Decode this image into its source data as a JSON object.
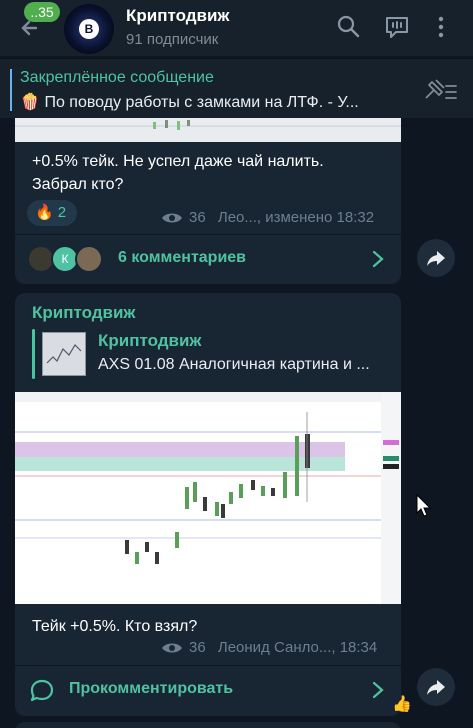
{
  "header": {
    "unread_count": "..35",
    "title": "Криптодвиж",
    "subtitle": "91 подписчик",
    "avatar_letter": "B"
  },
  "pinned": {
    "title": "Закреплённое сообщение",
    "text": "По поводу работы с замками на ЛТФ.  - У...",
    "emoji": "🍿"
  },
  "messages": [
    {
      "text_line1": "+0.5% тейк. Не успел даже чай налить.",
      "text_line2": "Забрал кто?",
      "reaction_emoji": "🔥",
      "reaction_count": "2",
      "views": "36",
      "meta": "Лео..., изменено 18:32",
      "comments_label": "6 комментариев",
      "comment_avatar_letter": "К"
    },
    {
      "sender": "Криптодвиж",
      "quote_title": "Криптодвиж",
      "quote_text": "AXS 01.08  Аналогичная картина и ...",
      "text": "Тейк +0.5%. Кто взял?",
      "views": "36",
      "meta": "Леонид Санло..., 18:34",
      "comment_action": "Прокомментировать"
    }
  ],
  "reactions": {
    "thumbs": "👍"
  },
  "colors": {
    "accent": "#4fc3a1",
    "badge": "#4fae4e",
    "bubble": "#182533",
    "background": "#0e1621",
    "header": "#17212b"
  }
}
